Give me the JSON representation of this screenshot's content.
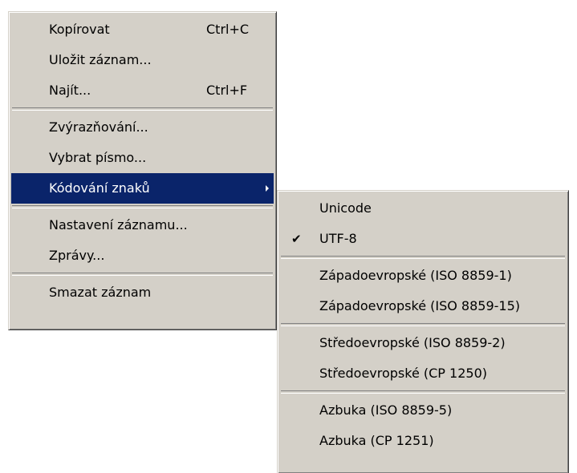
{
  "main_menu": {
    "items": [
      {
        "label": "Kopírovat",
        "shortcut": "Ctrl+C"
      },
      {
        "label": "Uložit záznam..."
      },
      {
        "label": "Najít...",
        "shortcut": "Ctrl+F"
      },
      {
        "label": "Zvýrazňování..."
      },
      {
        "label": "Vybrat písmo..."
      },
      {
        "label": "Kódování znaků",
        "highlighted": true,
        "has_submenu": true
      },
      {
        "label": "Nastavení záznamu..."
      },
      {
        "label": "Zprávy..."
      },
      {
        "label": "Smazat záznam"
      }
    ]
  },
  "submenu": {
    "items": [
      {
        "label": "Unicode"
      },
      {
        "label": "UTF-8",
        "checked": true
      },
      {
        "label": "Západoevropské (ISO 8859-1)"
      },
      {
        "label": "Západoevropské (ISO 8859-15)"
      },
      {
        "label": "Středoevropské (ISO 8859-2)"
      },
      {
        "label": "Středoevropské (CP 1250)"
      },
      {
        "label": "Azbuka (ISO 8859-5)"
      },
      {
        "label": "Azbuka (CP 1251)"
      }
    ],
    "check_glyph": "✔"
  },
  "colors": {
    "menu_background": "#d4d0c8",
    "highlight": "#0a246a",
    "highlight_text": "#ffffff"
  }
}
